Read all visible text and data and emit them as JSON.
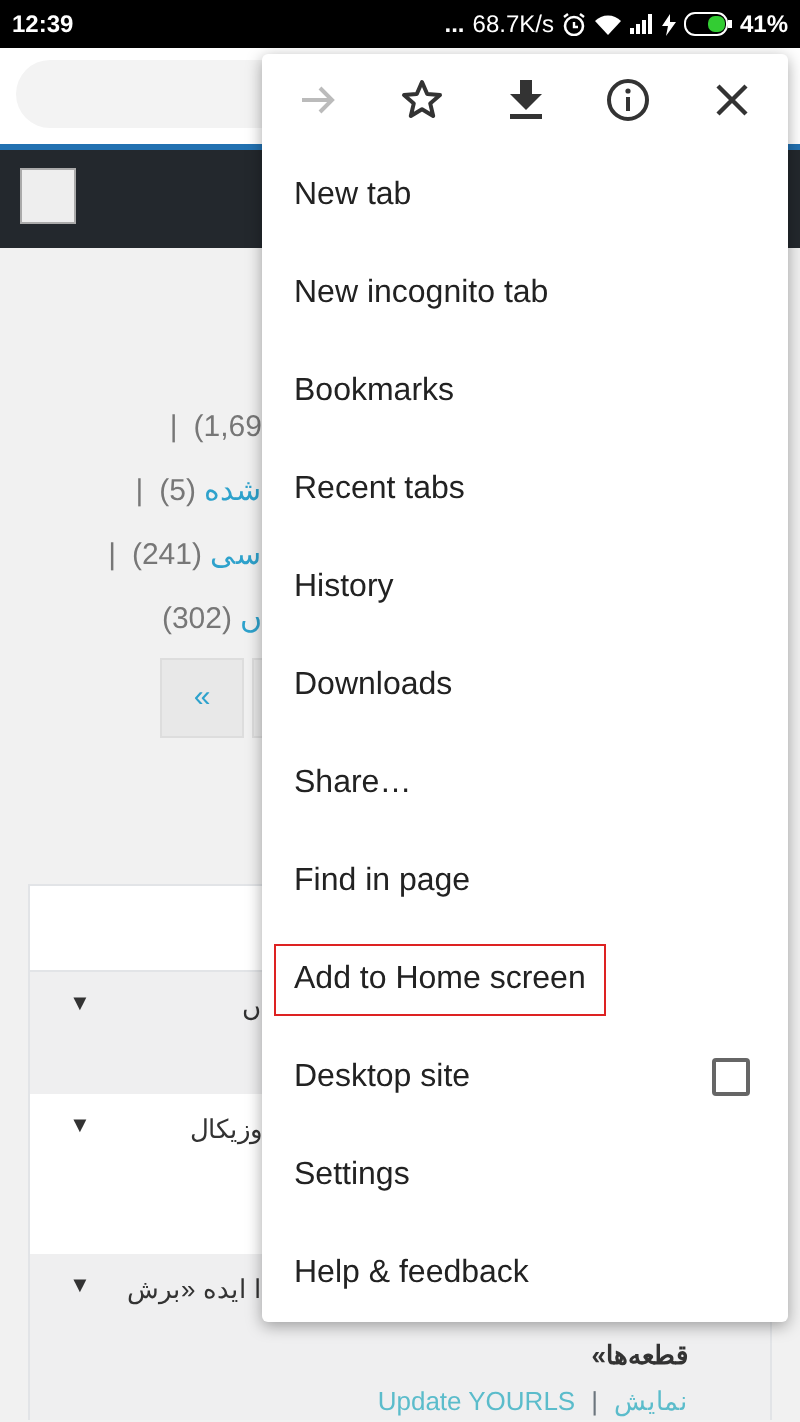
{
  "status_bar": {
    "time": "12:39",
    "more": "...",
    "speed": "68.7K/s",
    "battery": "41%"
  },
  "filters": [
    {
      "parts": [
        {
          "kind": "sep",
          "text": "|"
        },
        {
          "kind": "count",
          "text": "(1,69"
        }
      ]
    },
    {
      "parts": [
        {
          "kind": "sep",
          "text": "|"
        },
        {
          "kind": "count",
          "text": "(5)"
        },
        {
          "kind": "link",
          "text": "شده"
        }
      ]
    },
    {
      "parts": [
        {
          "kind": "sep",
          "text": "|"
        },
        {
          "kind": "count",
          "text": "(241)"
        },
        {
          "kind": "link",
          "text": "سی"
        }
      ]
    },
    {
      "parts": [
        {
          "kind": "count",
          "text": "(302)"
        },
        {
          "kind": "link",
          "text": "ں"
        }
      ]
    }
  ],
  "pagination": {
    "first": "«"
  },
  "table": {
    "rows": [
      {
        "toggle": "▼",
        "lines": [
          "ں"
        ],
        "striped": true
      },
      {
        "toggle": "▼",
        "lines": [
          "وزیکال"
        ],
        "striped": false
      },
      {
        "toggle": "▼",
        "lines": [
          "ا ایده «برش",
          "قطعه‌ها»"
        ],
        "striped": true,
        "actions": [
          "Update YOURLS",
          "نمایش"
        ],
        "action_sep": "|"
      }
    ]
  },
  "menu": {
    "top_icons": [
      {
        "kind": "forward",
        "disabled": true
      },
      {
        "kind": "star",
        "disabled": false
      },
      {
        "kind": "download",
        "disabled": false
      },
      {
        "kind": "info",
        "disabled": false
      },
      {
        "kind": "close",
        "disabled": false
      }
    ],
    "items": [
      {
        "label": "New tab",
        "highlighted": false
      },
      {
        "label": "New incognito tab",
        "highlighted": false
      },
      {
        "label": "Bookmarks",
        "highlighted": false
      },
      {
        "label": "Recent tabs",
        "highlighted": false
      },
      {
        "label": "History",
        "highlighted": false
      },
      {
        "label": "Downloads",
        "highlighted": false
      },
      {
        "label": "Share…",
        "highlighted": false
      },
      {
        "label": "Find in page",
        "highlighted": false
      },
      {
        "label": "Add to Home screen",
        "highlighted": true
      },
      {
        "label": "Desktop site",
        "highlighted": false,
        "kind": "checkbox",
        "checked": false
      },
      {
        "label": "Settings",
        "highlighted": false
      },
      {
        "label": "Help & feedback",
        "highlighted": false
      }
    ]
  }
}
